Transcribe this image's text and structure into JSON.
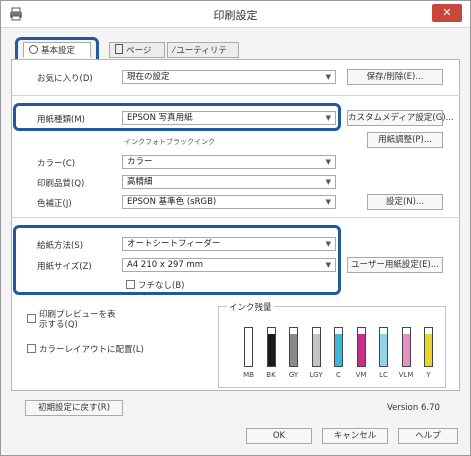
{
  "window": {
    "title": "印刷設定"
  },
  "tabs": [
    {
      "label": "基本設定"
    },
    {
      "label": "ページ設定"
    },
    {
      "label": "ユーティリティー"
    }
  ],
  "favorites": {
    "label": "お気に入り(D)",
    "value": "現在の設定",
    "save_button": "保存/削除(E)..."
  },
  "paper_type": {
    "label": "用紙種類(M)",
    "value": "EPSON 写真用紙",
    "note": "インクフォトブラックインク",
    "custom_button": "カスタムメディア設定(G)...",
    "adjust_button": "用紙調整(P)..."
  },
  "color": {
    "label": "カラー(C)",
    "value": "カラー"
  },
  "quality": {
    "label": "印刷品質(Q)",
    "value": "高精細"
  },
  "mode": {
    "label": "色補正(J)",
    "value": "EPSON 基準色 (sRGB)",
    "settings_button": "設定(N)..."
  },
  "feed": {
    "label": "給紙方法(S)",
    "value": "オートシートフィーダー"
  },
  "size": {
    "label": "用紙サイズ(Z)",
    "value": "A4 210 x 297 mm",
    "user_button": "ユーザー用紙設定(E)...",
    "borderless_label": "フチなし(B)"
  },
  "preview": {
    "label": "印刷プレビューを表示する(Q)"
  },
  "layout_manager": {
    "label": "カラーレイアウトに配置(L)"
  },
  "ink": {
    "title": "インク残量",
    "levels": [
      {
        "code": "MB",
        "color": "#2a2a2a",
        "level": 0.0
      },
      {
        "code": "BK",
        "color": "#1a1a1a",
        "level": 0.85
      },
      {
        "code": "GY",
        "color": "#8a8a8a",
        "level": 0.85
      },
      {
        "code": "LGY",
        "color": "#c4c4c4",
        "level": 0.85
      },
      {
        "code": "C",
        "color": "#3fb6dc",
        "level": 0.85
      },
      {
        "code": "VM",
        "color": "#c2308a",
        "level": 0.85
      },
      {
        "code": "LC",
        "color": "#8fd3ec",
        "level": 0.85
      },
      {
        "code": "VLM",
        "color": "#e58fc4",
        "level": 0.85
      },
      {
        "code": "Y",
        "color": "#e9d32e",
        "level": 0.85
      }
    ]
  },
  "reset_button": "初期設定に戻す(R)",
  "version": "Version 6.70",
  "footer": {
    "ok": "OK",
    "cancel": "キャンセル",
    "help": "ヘルプ"
  }
}
